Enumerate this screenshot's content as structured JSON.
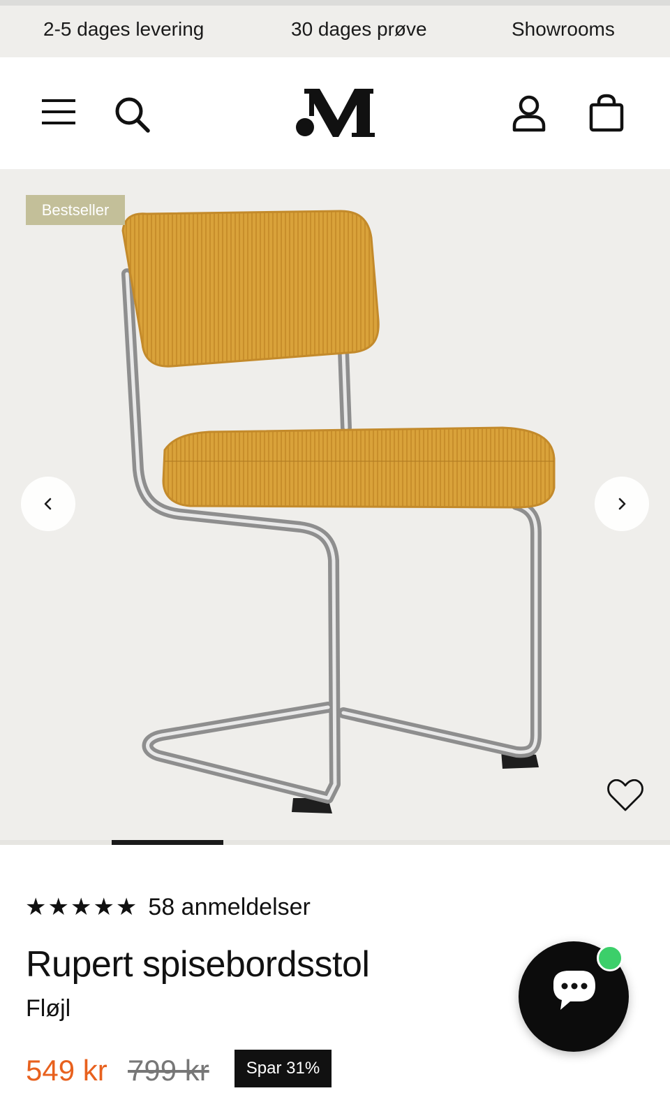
{
  "promo_bar": {
    "items": [
      "2-5 dages levering",
      "30 dages prøve",
      "Showrooms"
    ]
  },
  "header": {
    "menu_icon": "hamburger-icon",
    "search_icon": "search-icon",
    "logo_icon": "brand-logo",
    "account_icon": "user-icon",
    "cart_icon": "shopping-bag-icon"
  },
  "gallery": {
    "badge": "Bestseller",
    "prev_icon": "chevron-left-icon",
    "next_icon": "chevron-right-icon",
    "favorite_icon": "heart-icon",
    "active_slide_index": 2,
    "slide_count": 6
  },
  "product": {
    "rating_stars": "★★★★★",
    "reviews": "58 anmeldelser",
    "title": "Rupert spisebordsstol",
    "variant": "Fløjl",
    "price": "549 kr",
    "old_price": "799 kr",
    "discount": "Spar 31%"
  },
  "chat": {
    "icon": "chat-bubble-icon",
    "status_color": "#3ccf6a"
  },
  "colors": {
    "price": "#e8611e",
    "badge": "#c3bf99",
    "hero_background": "#efeeeb"
  }
}
